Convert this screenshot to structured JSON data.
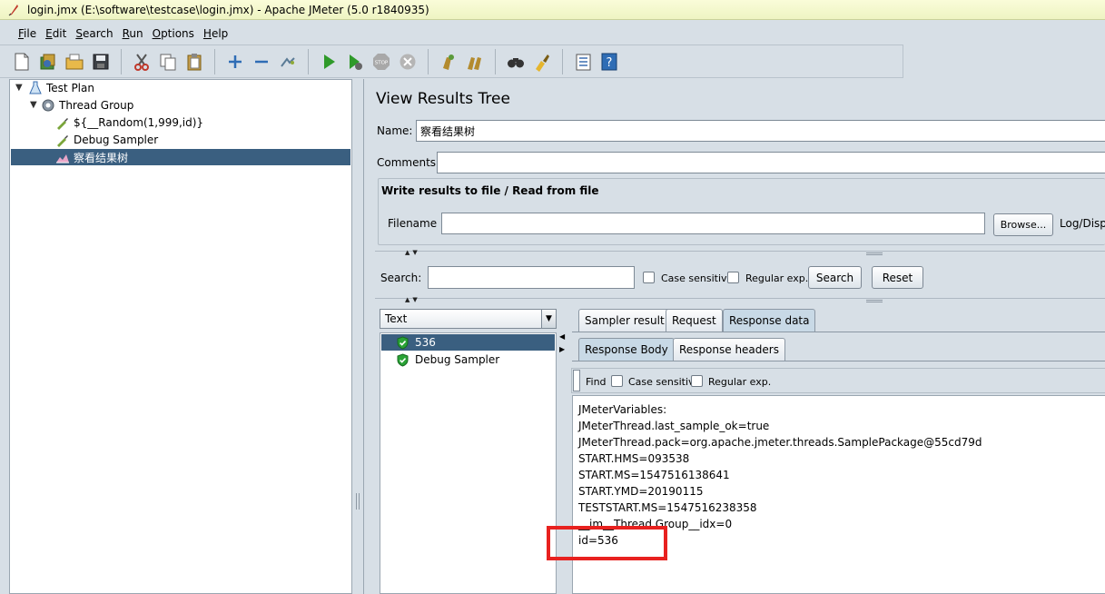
{
  "window": {
    "title": "login.jmx (E:\\software\\testcase\\login.jmx) - Apache JMeter (5.0 r1840935)"
  },
  "menu": [
    "File",
    "Edit",
    "Search",
    "Run",
    "Options",
    "Help"
  ],
  "toolbar": {
    "icons": [
      "new-icon",
      "templates-icon",
      "open-icon",
      "save-icon",
      "cut-icon",
      "copy-icon",
      "paste-icon",
      "expand-icon",
      "collapse-icon",
      "toggle-icon",
      "start-icon",
      "start-no-pauses-icon",
      "stop-icon",
      "shutdown-icon",
      "clear-icon",
      "clear-all-icon",
      "search-icon",
      "reset-search-icon",
      "function-helper-icon",
      "help-icon"
    ]
  },
  "tree": {
    "items": [
      {
        "label": "Test Plan",
        "level": 0
      },
      {
        "label": "Thread Group",
        "level": 1
      },
      {
        "label": "${__Random(1,999,id)}",
        "level": 2
      },
      {
        "label": "Debug Sampler",
        "level": 2
      },
      {
        "label": "察看结果树",
        "level": 2,
        "selected": true
      }
    ]
  },
  "panel": {
    "title": "View Results Tree",
    "name_label": "Name:",
    "name_value": "察看结果树",
    "comments_label": "Comments:",
    "comments_value": "",
    "file_section_title": "Write results to file / Read from file",
    "filename_label": "Filename",
    "filename_value": "",
    "browse_label": "Browse...",
    "log_label": "Log/Disp",
    "search_label": "Search:",
    "search_value": "",
    "case_sensitive_label": "Case sensitive",
    "regex_label": "Regular exp.",
    "search_button": "Search",
    "reset_button": "Reset"
  },
  "renderer": {
    "selected": "Text"
  },
  "results": [
    {
      "label": "536",
      "selected": true
    },
    {
      "label": "Debug Sampler",
      "selected": false
    }
  ],
  "tabs": {
    "main": [
      "Sampler result",
      "Request",
      "Response data"
    ],
    "main_active": "Response data",
    "sub": [
      "Response Body",
      "Response headers"
    ],
    "sub_active": "Response Body"
  },
  "find_bar": {
    "find_label": "Find",
    "case_sensitive_label": "Case sensitive",
    "regex_label": "Regular exp."
  },
  "response_body": [
    "JMeterVariables:",
    "JMeterThread.last_sample_ok=true",
    "JMeterThread.pack=org.apache.jmeter.threads.SamplePackage@55cd79d",
    "START.HMS=093538",
    "START.MS=1547516138641",
    "START.YMD=20190115",
    "TESTSTART.MS=1547516238358",
    "__jm__Thread Group__idx=0",
    "id=536"
  ],
  "colors": {
    "selection": "#3a5f80",
    "highlight_box": "#e8211f",
    "background": "#d7dfe6"
  }
}
